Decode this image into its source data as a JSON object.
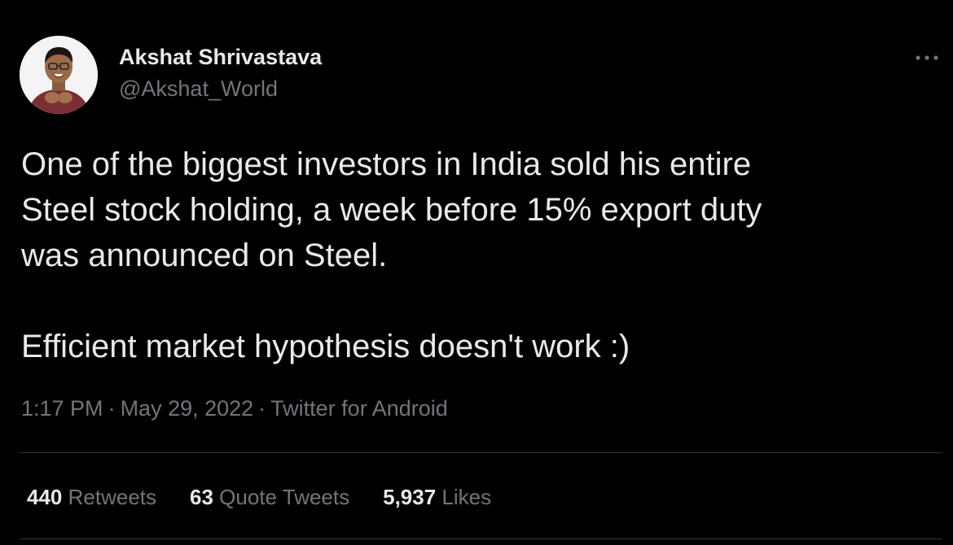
{
  "user": {
    "display_name": "Akshat Shrivastava",
    "handle": "@Akshat_World"
  },
  "tweet": {
    "paragraph_1_lines": [
      "One of the biggest investors in India sold his entire",
      "Steel stock holding, a week before 15% export duty",
      "was announced on Steel."
    ],
    "paragraph_2": "Efficient market hypothesis doesn't work :)"
  },
  "meta": {
    "time": "1:17 PM",
    "separator": "·",
    "date": "May 29, 2022",
    "source": "Twitter for Android"
  },
  "stats": {
    "retweets_count": "440",
    "retweets_label": "Retweets",
    "quotes_count": "63",
    "quotes_label": "Quote Tweets",
    "likes_count": "5,937",
    "likes_label": "Likes"
  },
  "icons": {
    "more": "more-horizontal-icon"
  },
  "colors": {
    "background": "#000000",
    "primary_text": "#e7e9ea",
    "secondary_text": "#71767b",
    "divider": "#2f3336"
  }
}
